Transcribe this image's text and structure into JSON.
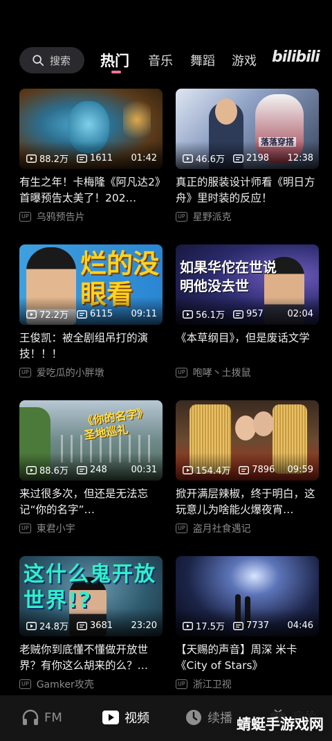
{
  "header": {
    "search_placeholder": "搜索",
    "tabs": [
      "热门",
      "音乐",
      "舞蹈",
      "游戏"
    ],
    "active_tab": "热门",
    "logo": "bilibili"
  },
  "up_badge": "UP",
  "videos": [
    {
      "views": "88.2万",
      "danmaku": "1611",
      "duration": "01:42",
      "title": "有生之年！卡梅隆《阿凡达2》首曝预告太美了！202…",
      "uploader": "乌鸦预告片"
    },
    {
      "views": "46.6万",
      "danmaku": "2198",
      "duration": "12:38",
      "title": "真正的服装设计师看《明日方舟》里时装的反应！",
      "uploader": "星野派克",
      "thumb_text": "落落穿搭"
    },
    {
      "views": "72.2万",
      "danmaku": "6115",
      "duration": "09:11",
      "title": "王俊凯：被全剧组吊打的演技！！！",
      "uploader": "爱吃瓜的小胖墩",
      "thumb_text": "烂的没眼看"
    },
    {
      "views": "56.1万",
      "danmaku": "957",
      "duration": "02:04",
      "title": "《本草纲目》，但是废话文学",
      "uploader": "咆哮丶土拨鼠",
      "thumb_text": "如果华佗在世说明他没去世"
    },
    {
      "views": "88.6万",
      "danmaku": "248",
      "duration": "00:31",
      "title": "来过很多次，但还是无法忘记“你的名字”…",
      "uploader": "東君小宇",
      "thumb_text": "《你的名字》圣地巡礼"
    },
    {
      "views": "154.4万",
      "danmaku": "7896",
      "duration": "09:59",
      "title": "掀开满层辣椒，终于明白，这玩意儿为啥能火爆夜宵…",
      "uploader": "盗月社食遇记"
    },
    {
      "views": "24.8万",
      "danmaku": "3681",
      "duration": "23:20",
      "title": "老贼你到底懂不懂做开放世界？有你这么胡来的么？…",
      "uploader": "Gamker攻壳",
      "thumb_text": "这什么鬼开放世界!?"
    },
    {
      "views": "17.5万",
      "danmaku": "7737",
      "duration": "04:46",
      "title": "【天赐的声音】周深 米卡《City of Stars》",
      "uploader": "浙江卫视"
    }
  ],
  "bottom_nav": [
    {
      "label": "FM",
      "icon": "headphones-icon",
      "active": false
    },
    {
      "label": "视频",
      "icon": "play-icon",
      "active": true
    },
    {
      "label": "续播",
      "icon": "clock-icon",
      "active": false
    },
    {
      "label": "我的",
      "icon": "tv-icon",
      "active": false
    }
  ],
  "watermark": "蜻蜓手游戏网",
  "colors": {
    "accent": "#fb7299",
    "background": "#000000"
  }
}
